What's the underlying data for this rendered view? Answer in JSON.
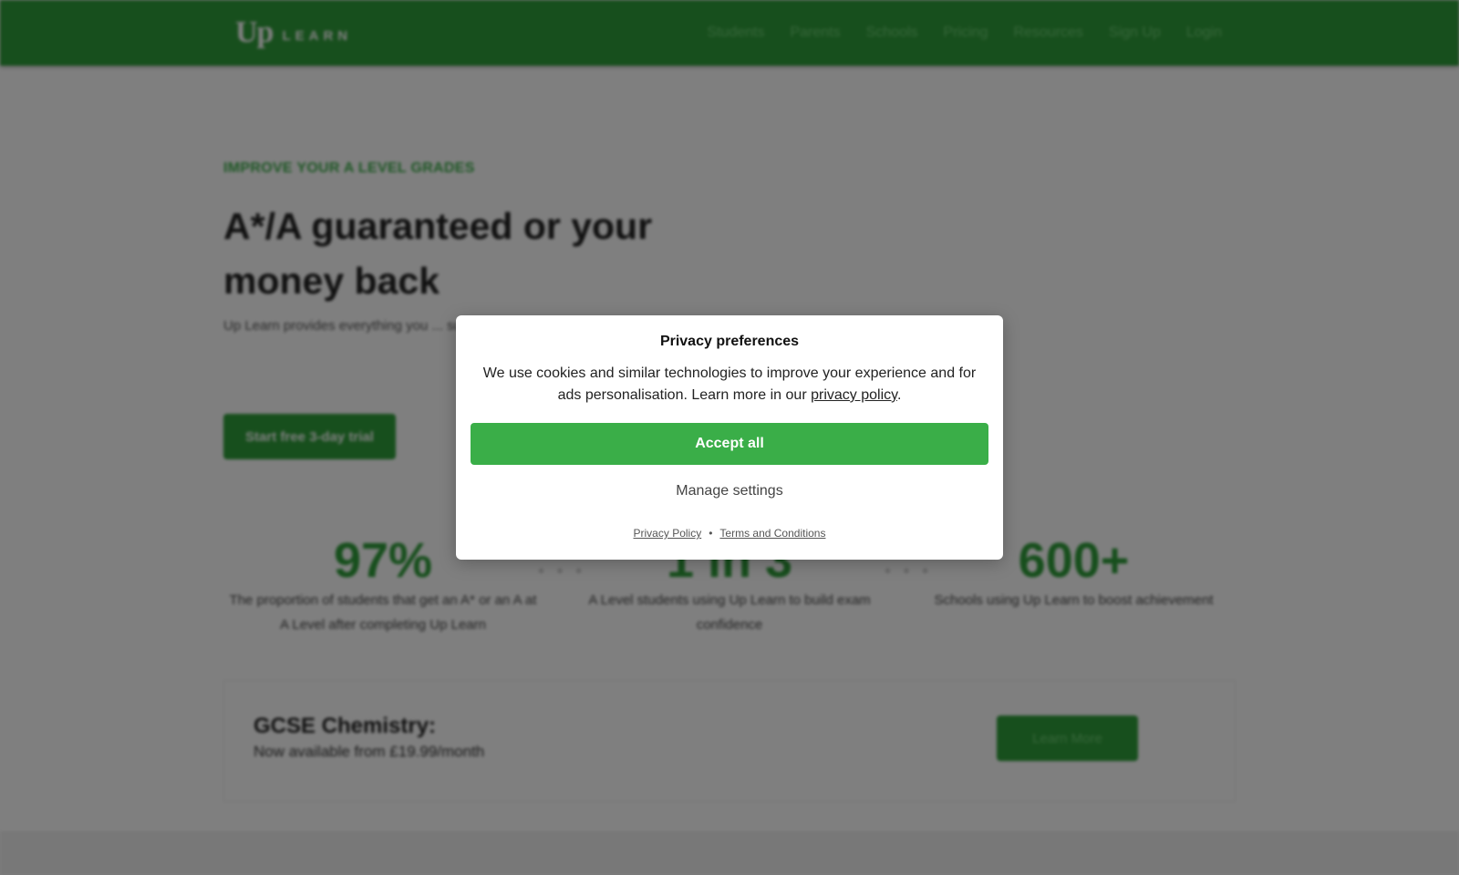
{
  "header": {
    "logo_mark": "Up",
    "logo_text": "LEARN",
    "nav": [
      "Students",
      "Parents",
      "Schools",
      "Pricing",
      "Resources",
      "Sign Up",
      "Login"
    ]
  },
  "hero": {
    "eyebrow": "IMPROVE YOUR A LEVEL GRADES",
    "title": "A*/A guaranteed or your money back",
    "text": "Up Learn provides everything you ... subject, as efficiently as possible. N...",
    "cta": "Start free 3-day trial"
  },
  "stats": [
    {
      "value": "97%",
      "desc": "The proportion of students that get an A* or an A at A Level after completing Up Learn"
    },
    {
      "value": "1 in 3",
      "desc": "A Level students using Up Learn to build exam confidence"
    },
    {
      "value": "600+",
      "desc": "Schools using Up Learn to boost achievement"
    }
  ],
  "stat_dots": "• • •",
  "promo": {
    "title": "GCSE Chemistry:",
    "subtitle": "Now available from £19.99/month",
    "button": "Learn More"
  },
  "dialog": {
    "title": "Privacy preferences",
    "text_before": "We use cookies and similar technologies to improve your experience and for ads personalisation. Learn more in our ",
    "text_link": "privacy policy",
    "text_after": ".",
    "accept": "Accept all",
    "manage": "Manage settings",
    "footer_privacy": "Privacy Policy",
    "footer_sep": "•",
    "footer_terms": "Terms and Conditions"
  },
  "colors": {
    "brand_green": "#2f9e3a",
    "accept_green": "#3aae48",
    "overlay": "rgba(0,0,0,0.5)"
  }
}
